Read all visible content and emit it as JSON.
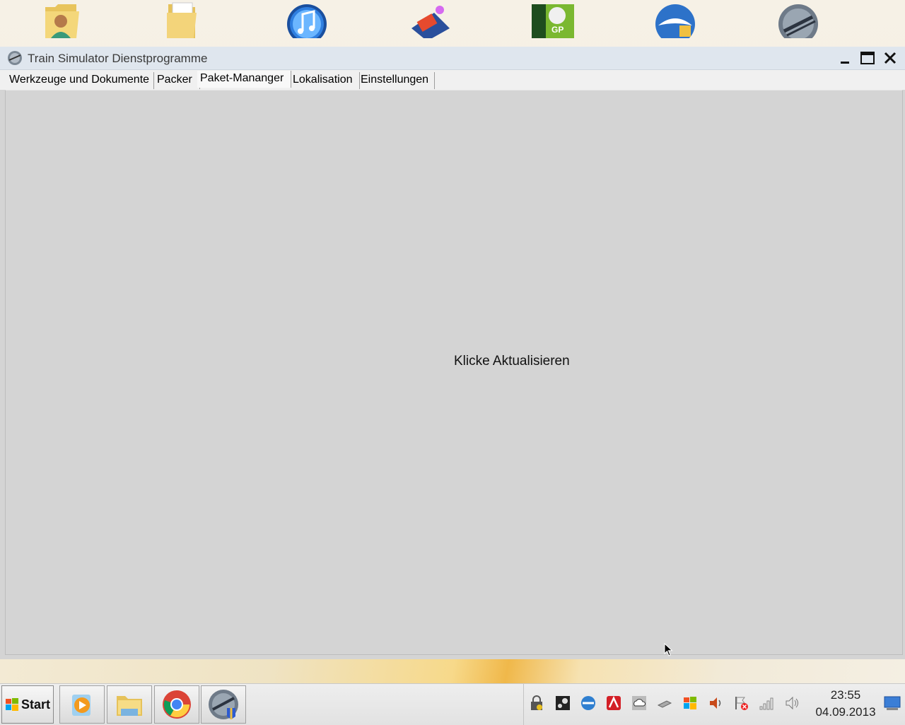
{
  "desktop": {
    "icons": [
      "user-folder-icon",
      "folder-icon",
      "itunes-icon",
      "game-icon",
      "more-gp-icon",
      "thunderbird-icon",
      "train-simulator-icon"
    ]
  },
  "window": {
    "title": "Train Simulator Dienstprogramme",
    "tabs": [
      {
        "label": "Werkzeuge und Dokumente",
        "active": false
      },
      {
        "label": "Packer",
        "active": false
      },
      {
        "label": "Paket-Mananger",
        "active": true
      },
      {
        "label": "Lokalisation",
        "active": false
      },
      {
        "label": "Einstellungen",
        "active": false
      }
    ],
    "panel_message": "Klicke Aktualisieren"
  },
  "taskbar": {
    "start_label": "Start",
    "pinned": [
      "media-player-icon",
      "explorer-icon",
      "chrome-icon",
      "train-simulator-icon"
    ],
    "tray_icons": [
      "security-lock-icon",
      "steam-icon",
      "app-icon",
      "avira-icon",
      "cloud-icon",
      "usb-drive-icon",
      "windows-update-icon",
      "speaker-icon",
      "action-center-flag-icon",
      "network-signal-icon",
      "volume-icon"
    ],
    "clock_time": "23:55",
    "clock_date": "04.09.2013"
  },
  "colors": {
    "window_bg": "#d4d4d4",
    "titlebar_bg": "#dfe6ee",
    "tabbar_bg": "#f0f0f0"
  }
}
